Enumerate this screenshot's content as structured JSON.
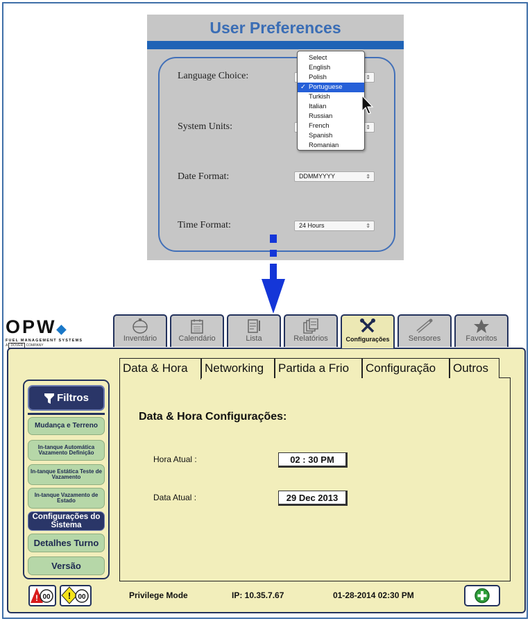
{
  "prefs": {
    "title": "User Preferences",
    "language_label": "Language Choice:",
    "units_label": "System Units:",
    "date_label": "Date Format:",
    "date_value": "DDMMYYYY",
    "time_label": "Time Format:",
    "time_value": "24 Hours",
    "language_options": [
      "Select",
      "English",
      "Polish",
      "Portuguese",
      "Turkish",
      "Italian",
      "Russian",
      "French",
      "Spanish",
      "Romanian"
    ],
    "selected_language": "Portuguese",
    "check_mark": "✓"
  },
  "logo": {
    "name": "OPW",
    "tagline": "FUEL MANAGEMENT SYSTEMS",
    "parent_prefix": "A",
    "parent_name": "DOVER",
    "parent_suffix": "COMPANY"
  },
  "tabs": [
    {
      "label": "Inventário",
      "icon": "tank-icon"
    },
    {
      "label": "Calendário",
      "icon": "calendar-icon"
    },
    {
      "label": "Lista",
      "icon": "list-icon"
    },
    {
      "label": "Relatórios",
      "icon": "reports-icon"
    },
    {
      "label": "Configurações",
      "icon": "tools-icon",
      "active": true
    },
    {
      "label": "Sensores",
      "icon": "sensor-icon"
    },
    {
      "label": "Favoritos",
      "icon": "star-icon"
    }
  ],
  "sidebar": {
    "filter_label": "Filtros",
    "items": [
      "Mudança e Terreno",
      "In-tanque Automática Vazamento Definição",
      "In-tanque Estática Teste de Vazamento",
      "In-tanque Vazamento de Estado",
      "Configurações do Sistema",
      "Detalhes Turno",
      "Versão"
    ]
  },
  "subtabs": [
    "Data & Hora",
    "Networking",
    "Partida a Frio",
    "Configuração",
    "Outros"
  ],
  "content": {
    "heading": "Data & Hora Configurações:",
    "time_label": "Hora Atual :",
    "time_value": "02 : 30 PM",
    "date_label": "Data Atual :",
    "date_value": "29 Dec 2013"
  },
  "status": {
    "alarm_count": "00",
    "warning_count": "00",
    "mode": "Privilege Mode",
    "ip": "IP: 10.35.7.67",
    "datetime": "01-28-2014 02:30 PM"
  },
  "colors": {
    "panel_bg": "#f2eebb",
    "navy": "#23325d",
    "button_green": "#b6d7a8",
    "prefs_blue": "#1f63b6",
    "add_green": "#2e9e3a"
  }
}
